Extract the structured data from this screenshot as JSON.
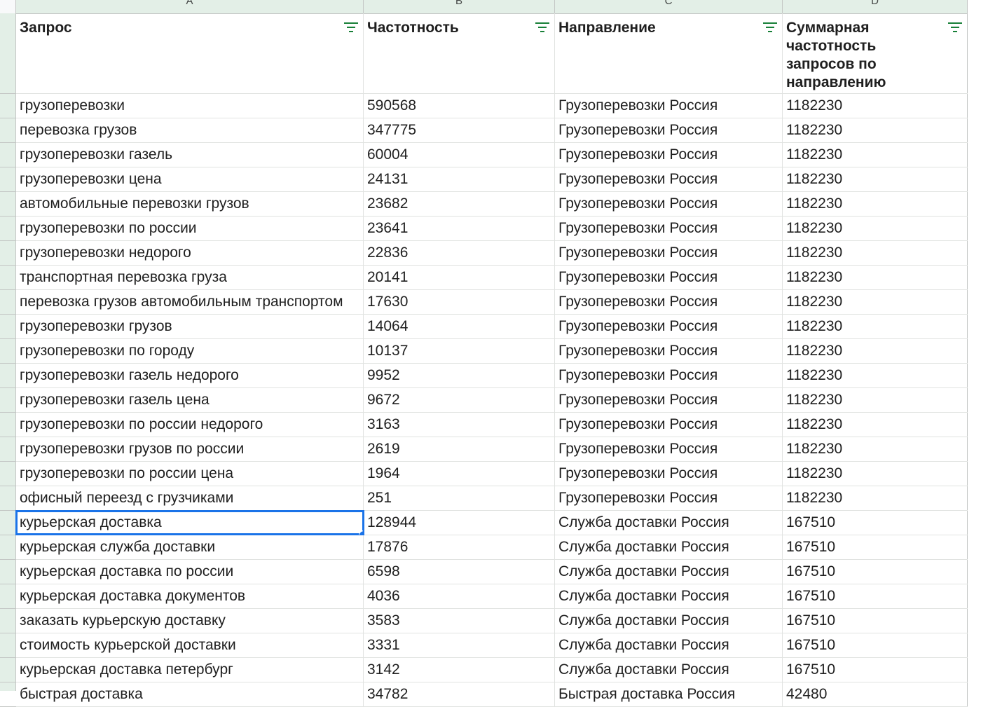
{
  "columns": [
    "A",
    "B",
    "C",
    "D"
  ],
  "headers": {
    "query": "Запрос",
    "frequency": "Частотность",
    "direction": "Направление",
    "total": "Суммарная частотность запросов по направлению"
  },
  "rows": [
    {
      "query": "грузоперевозки",
      "frequency": "590568",
      "direction": "Грузоперевозки Россия",
      "total": "1182230"
    },
    {
      "query": "перевозка грузов",
      "frequency": "347775",
      "direction": "Грузоперевозки Россия",
      "total": "1182230"
    },
    {
      "query": "грузоперевозки газель",
      "frequency": "60004",
      "direction": "Грузоперевозки Россия",
      "total": "1182230"
    },
    {
      "query": "грузоперевозки цена",
      "frequency": "24131",
      "direction": "Грузоперевозки Россия",
      "total": "1182230"
    },
    {
      "query": "автомобильные перевозки грузов",
      "frequency": "23682",
      "direction": "Грузоперевозки Россия",
      "total": "1182230"
    },
    {
      "query": "грузоперевозки по россии",
      "frequency": "23641",
      "direction": "Грузоперевозки Россия",
      "total": "1182230"
    },
    {
      "query": "грузоперевозки недорого",
      "frequency": "22836",
      "direction": "Грузоперевозки Россия",
      "total": "1182230"
    },
    {
      "query": "транспортная перевозка груза",
      "frequency": "20141",
      "direction": "Грузоперевозки Россия",
      "total": "1182230"
    },
    {
      "query": "перевозка грузов автомобильным транспортом",
      "frequency": "17630",
      "direction": "Грузоперевозки Россия",
      "total": "1182230"
    },
    {
      "query": "грузоперевозки грузов",
      "frequency": "14064",
      "direction": "Грузоперевозки Россия",
      "total": "1182230"
    },
    {
      "query": "грузоперевозки по городу",
      "frequency": "10137",
      "direction": "Грузоперевозки Россия",
      "total": "1182230"
    },
    {
      "query": "грузоперевозки газель недорого",
      "frequency": "9952",
      "direction": "Грузоперевозки Россия",
      "total": "1182230"
    },
    {
      "query": "грузоперевозки газель цена",
      "frequency": "9672",
      "direction": "Грузоперевозки Россия",
      "total": "1182230"
    },
    {
      "query": "грузоперевозки по россии недорого",
      "frequency": "3163",
      "direction": "Грузоперевозки Россия",
      "total": "1182230"
    },
    {
      "query": "грузоперевозки грузов по россии",
      "frequency": "2619",
      "direction": "Грузоперевозки Россия",
      "total": "1182230"
    },
    {
      "query": "грузоперевозки по россии цена",
      "frequency": "1964",
      "direction": "Грузоперевозки Россия",
      "total": "1182230"
    },
    {
      "query": "офисный переезд с грузчиками",
      "frequency": "251",
      "direction": "Грузоперевозки Россия",
      "total": "1182230"
    },
    {
      "query": "курьерская доставка",
      "frequency": "128944",
      "direction": "Служба доставки Россия",
      "total": "167510"
    },
    {
      "query": "курьерская служба доставки",
      "frequency": "17876",
      "direction": "Служба доставки Россия",
      "total": "167510"
    },
    {
      "query": "курьерская доставка по россии",
      "frequency": "6598",
      "direction": "Служба доставки Россия",
      "total": "167510"
    },
    {
      "query": "курьерская доставка документов",
      "frequency": "4036",
      "direction": "Служба доставки Россия",
      "total": "167510"
    },
    {
      "query": "заказать курьерскую доставку",
      "frequency": "3583",
      "direction": "Служба доставки Россия",
      "total": "167510"
    },
    {
      "query": "стоимость курьерской доставки",
      "frequency": "3331",
      "direction": "Служба доставки Россия",
      "total": "167510"
    },
    {
      "query": "курьерская доставка петербург",
      "frequency": "3142",
      "direction": "Служба доставки Россия",
      "total": "167510"
    },
    {
      "query": "быстрая доставка",
      "frequency": "34782",
      "direction": "Быстрая доставка Россия",
      "total": "42480"
    }
  ],
  "selected_row_index": 17,
  "colors": {
    "selection": "#1a73e8",
    "header_strip": "#e3efe7",
    "grid_line": "#e1e3e1"
  },
  "icons": {
    "filter": "filter-icon"
  }
}
